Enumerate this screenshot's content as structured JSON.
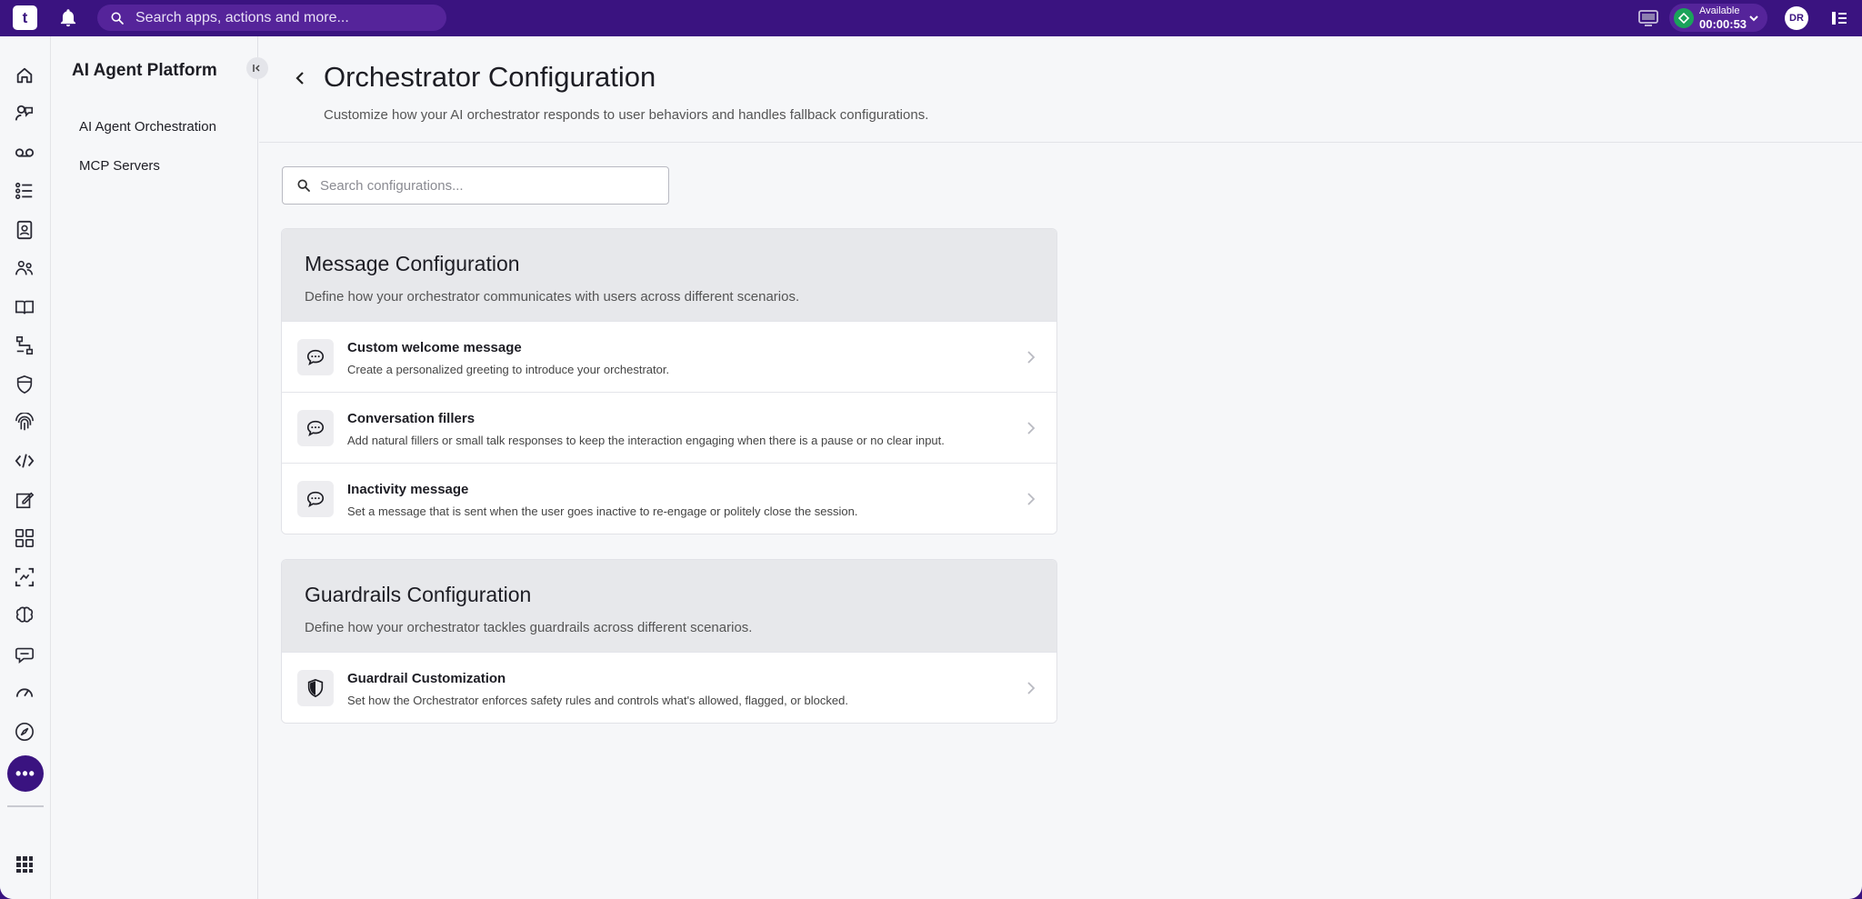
{
  "topbar": {
    "logo_text": "t",
    "search_placeholder": "Search apps, actions and more...",
    "status_label": "Available",
    "status_timer": "00:00:53",
    "avatar_initials": "DR"
  },
  "rail": {
    "icons": [
      "home-icon",
      "agent-icon",
      "voicemail-icon",
      "list-icon",
      "contacts-icon",
      "team-icon",
      "knowledge-icon",
      "flow-icon",
      "shield-icon",
      "fingerprint-icon",
      "code-icon",
      "edit-icon",
      "apps-grid-icon",
      "scan-icon",
      "brain-icon",
      "chat-icon",
      "gauge-icon",
      "compass-icon"
    ],
    "more_icon": "more-icon",
    "bottom_icon": "app-launcher-icon"
  },
  "subnav": {
    "title": "AI Agent Platform",
    "items": [
      {
        "label": "AI Agent Orchestration"
      },
      {
        "label": "MCP Servers"
      }
    ]
  },
  "page": {
    "title": "Orchestrator Configuration",
    "subtitle": "Customize how your AI orchestrator responds to user behaviors and handles fallback configurations.",
    "search_placeholder": "Search configurations..."
  },
  "sections": [
    {
      "title": "Message Configuration",
      "description": "Define how your orchestrator communicates with users across different scenarios.",
      "items": [
        {
          "title": "Custom welcome message",
          "description": "Create a personalized greeting to introduce your orchestrator.",
          "icon": "chat-bubble-icon"
        },
        {
          "title": "Conversation fillers",
          "description": "Add natural fillers or small talk responses to keep the interaction engaging when there is a pause or no clear input.",
          "icon": "chat-bubble-icon"
        },
        {
          "title": "Inactivity message",
          "description": "Set a message that is sent when the user goes inactive to re-engage or politely close the session.",
          "icon": "chat-bubble-icon"
        }
      ]
    },
    {
      "title": "Guardrails Configuration",
      "description": "Define how your orchestrator tackles guardrails across different scenarios.",
      "items": [
        {
          "title": "Guardrail Customization",
          "description": "Set how the Orchestrator enforces safety rules and controls what's allowed, flagged, or blocked.",
          "icon": "shield-icon"
        }
      ]
    }
  ],
  "colors": {
    "brand": "#3a1380",
    "status": "#1aa35a",
    "background": "#f6f7f9"
  }
}
